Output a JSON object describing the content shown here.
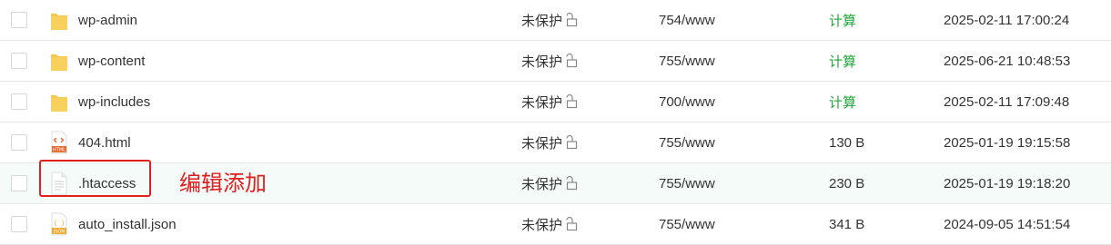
{
  "rows": [
    {
      "type": "folder",
      "name": "wp-admin",
      "permission": "未保护",
      "owner": "754/www",
      "size": "计算",
      "size_is_action": true,
      "date": "2025-02-11 17:00:24"
    },
    {
      "type": "folder",
      "name": "wp-content",
      "permission": "未保护",
      "owner": "755/www",
      "size": "计算",
      "size_is_action": true,
      "date": "2025-06-21 10:48:53"
    },
    {
      "type": "folder",
      "name": "wp-includes",
      "permission": "未保护",
      "owner": "700/www",
      "size": "计算",
      "size_is_action": true,
      "date": "2025-02-11 17:09:48"
    },
    {
      "type": "html",
      "icon_label": "HTML",
      "name": "404.html",
      "permission": "未保护",
      "owner": "755/www",
      "size": "130 B",
      "size_is_action": false,
      "date": "2025-01-19 19:15:58"
    },
    {
      "type": "text",
      "name": ".htaccess",
      "permission": "未保护",
      "owner": "755/www",
      "size": "230 B",
      "size_is_action": false,
      "date": "2025-01-19 19:18:20"
    },
    {
      "type": "json",
      "icon_label": "JSON",
      "name": "auto_install.json",
      "permission": "未保护",
      "owner": "755/www",
      "size": "341 B",
      "size_is_action": false,
      "date": "2024-09-05 14:51:54"
    }
  ],
  "annotation": {
    "text": "编辑添加",
    "color": "#e02020"
  },
  "colors": {
    "folder": "#f5c74a",
    "accent_green": "#20a53a",
    "html_icon": "#e8692b",
    "json_icon": "#f0a92e",
    "highlight_row": "#f5fbf8"
  },
  "icons": {
    "folder": "folder-icon",
    "html": "html-file-icon",
    "text": "text-file-icon",
    "json": "json-file-icon",
    "lock": "unlock-icon"
  }
}
